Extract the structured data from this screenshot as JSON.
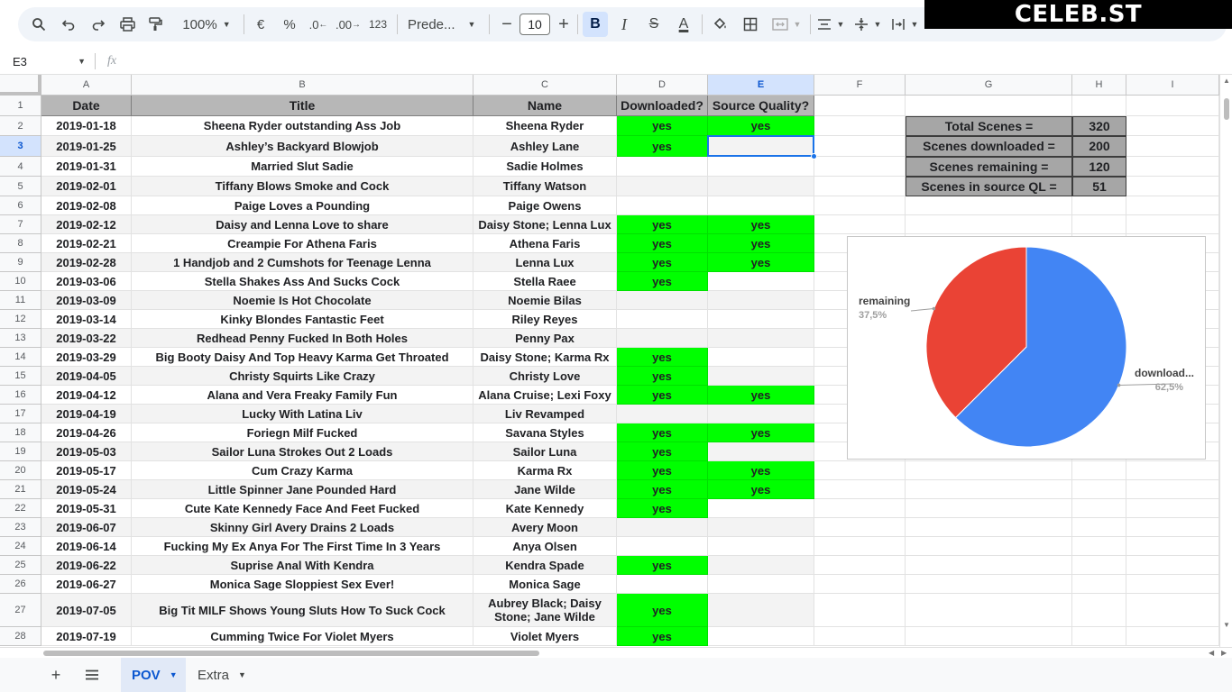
{
  "toolbar": {
    "zoom": "100%",
    "currency": "€",
    "percent": "%",
    "dec_decrease": ".0",
    "dec_increase": ".00",
    "number_format": "123",
    "font": "Prede...",
    "font_size": "10",
    "bold": "B",
    "italic": "I",
    "strike": "S",
    "text_color": "A"
  },
  "brand": "CELEB.ST",
  "formula_bar": {
    "cell_ref": "E3",
    "fx": "fx",
    "value": ""
  },
  "columns": [
    "A",
    "B",
    "C",
    "D",
    "E",
    "F",
    "G",
    "H",
    "I"
  ],
  "selected_column": "E",
  "selected_row": "3",
  "headers": {
    "date": "Date",
    "title": "Title",
    "name": "Name",
    "downloaded": "Downloaded?",
    "quality": "Source Quality?"
  },
  "rows": [
    {
      "num": "2",
      "date": "2019-01-18",
      "title": "Sheena Ryder outstanding Ass Job",
      "name": "Sheena Ryder",
      "downloaded": "yes",
      "quality": "yes"
    },
    {
      "num": "3",
      "date": "2019-01-25",
      "title": "Ashley’s Backyard Blowjob",
      "name": "Ashley Lane",
      "downloaded": "yes",
      "quality": ""
    },
    {
      "num": "4",
      "date": "2019-01-31",
      "title": "Married Slut Sadie",
      "name": "Sadie Holmes",
      "downloaded": "",
      "quality": ""
    },
    {
      "num": "5",
      "date": "2019-02-01",
      "title": "Tiffany Blows Smoke and Cock",
      "name": "Tiffany Watson",
      "downloaded": "",
      "quality": ""
    },
    {
      "num": "6",
      "date": "2019-02-08",
      "title": "Paige Loves a Pounding",
      "name": "Paige Owens",
      "downloaded": "",
      "quality": ""
    },
    {
      "num": "7",
      "date": "2019-02-12",
      "title": "Daisy and Lenna Love to share",
      "name": "Daisy Stone; Lenna Lux",
      "downloaded": "yes",
      "quality": "yes"
    },
    {
      "num": "8",
      "date": "2019-02-21",
      "title": "Creampie For Athena Faris",
      "name": "Athena Faris",
      "downloaded": "yes",
      "quality": "yes"
    },
    {
      "num": "9",
      "date": "2019-02-28",
      "title": "1 Handjob and 2 Cumshots for Teenage Lenna",
      "name": "Lenna Lux",
      "downloaded": "yes",
      "quality": "yes"
    },
    {
      "num": "10",
      "date": "2019-03-06",
      "title": "Stella Shakes Ass And Sucks Cock",
      "name": "Stella Raee",
      "downloaded": "yes",
      "quality": ""
    },
    {
      "num": "11",
      "date": "2019-03-09",
      "title": "Noemie Is Hot Chocolate",
      "name": "Noemie Bilas",
      "downloaded": "",
      "quality": ""
    },
    {
      "num": "12",
      "date": "2019-03-14",
      "title": "Kinky Blondes Fantastic Feet",
      "name": "Riley Reyes",
      "downloaded": "",
      "quality": ""
    },
    {
      "num": "13",
      "date": "2019-03-22",
      "title": "Redhead Penny Fucked In Both Holes",
      "name": "Penny Pax",
      "downloaded": "",
      "quality": ""
    },
    {
      "num": "14",
      "date": "2019-03-29",
      "title": "Big Booty Daisy And Top Heavy Karma Get Throated",
      "name": "Daisy Stone; Karma Rx",
      "downloaded": "yes",
      "quality": ""
    },
    {
      "num": "15",
      "date": "2019-04-05",
      "title": "Christy Squirts Like Crazy",
      "name": "Christy Love",
      "downloaded": "yes",
      "quality": ""
    },
    {
      "num": "16",
      "date": "2019-04-12",
      "title": "Alana and Vera Freaky Family Fun",
      "name": "Alana Cruise; Lexi Foxy",
      "downloaded": "yes",
      "quality": "yes"
    },
    {
      "num": "17",
      "date": "2019-04-19",
      "title": "Lucky With Latina Liv",
      "name": "Liv Revamped",
      "downloaded": "",
      "quality": ""
    },
    {
      "num": "18",
      "date": "2019-04-26",
      "title": "Foriegn Milf Fucked",
      "name": "Savana Styles",
      "downloaded": "yes",
      "quality": "yes"
    },
    {
      "num": "19",
      "date": "2019-05-03",
      "title": "Sailor Luna Strokes Out 2 Loads",
      "name": "Sailor Luna",
      "downloaded": "yes",
      "quality": ""
    },
    {
      "num": "20",
      "date": "2019-05-17",
      "title": "Cum Crazy Karma",
      "name": "Karma Rx",
      "downloaded": "yes",
      "quality": "yes"
    },
    {
      "num": "21",
      "date": "2019-05-24",
      "title": "Little Spinner Jane Pounded Hard",
      "name": "Jane Wilde",
      "downloaded": "yes",
      "quality": "yes"
    },
    {
      "num": "22",
      "date": "2019-05-31",
      "title": "Cute Kate Kennedy Face And Feet Fucked",
      "name": "Kate Kennedy",
      "downloaded": "yes",
      "quality": ""
    },
    {
      "num": "23",
      "date": "2019-06-07",
      "title": "Skinny Girl Avery Drains 2 Loads",
      "name": "Avery Moon",
      "downloaded": "",
      "quality": ""
    },
    {
      "num": "24",
      "date": "2019-06-14",
      "title": "Fucking My Ex Anya For The First Time In 3 Years",
      "name": "Anya Olsen",
      "downloaded": "",
      "quality": ""
    },
    {
      "num": "25",
      "date": "2019-06-22",
      "title": "Suprise Anal With Kendra",
      "name": "Kendra Spade",
      "downloaded": "yes",
      "quality": ""
    },
    {
      "num": "26",
      "date": "2019-06-27",
      "title": "Monica Sage Sloppiest Sex Ever!",
      "name": "Monica Sage",
      "downloaded": "",
      "quality": ""
    },
    {
      "num": "27",
      "date": "2019-07-05",
      "title": "Big Tit MILF Shows Young Sluts How To Suck Cock",
      "name": "Aubrey Black; Daisy Stone; Jane Wilde",
      "downloaded": "yes",
      "quality": ""
    },
    {
      "num": "28",
      "date": "2019-07-19",
      "title": "Cumming Twice For Violet Myers",
      "name": "Violet Myers",
      "downloaded": "yes",
      "quality": ""
    }
  ],
  "stats": [
    {
      "label": "Total Scenes =",
      "value": "320"
    },
    {
      "label": "Scenes downloaded =",
      "value": "200"
    },
    {
      "label": "Scenes remaining =",
      "value": "120"
    },
    {
      "label": "Scenes in source QL =",
      "value": "51"
    }
  ],
  "chart_data": {
    "type": "pie",
    "slices": [
      {
        "label": "download...",
        "value": 200,
        "percent": "62,5%",
        "color": "#4285f4"
      },
      {
        "label": "remaining",
        "value": 120,
        "percent": "37,5%",
        "color": "#ea4335"
      }
    ]
  },
  "sheet_tabs": [
    {
      "label": "POV",
      "active": true
    },
    {
      "label": "Extra",
      "active": false
    }
  ],
  "colors": {
    "green": "#00ff00",
    "header_gray": "#b7b7b7",
    "stat_gray": "#a6a6a6",
    "selection": "#1a73e8"
  }
}
